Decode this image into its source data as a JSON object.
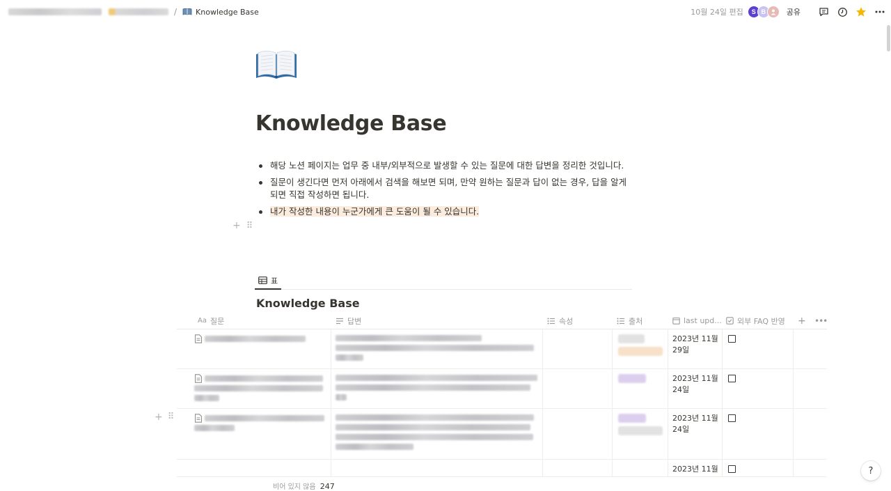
{
  "topbar": {
    "breadcrumb_title": "Knowledge Base",
    "separator": "/",
    "edited": "10월 24일 편집",
    "avatars": [
      "S",
      "B",
      ""
    ],
    "share": "공유"
  },
  "page": {
    "icon": "book-icon",
    "title": "Knowledge Base",
    "bullets": [
      "해당 노션 페이지는 업무 중 내부/외부적으로 발생할 수 있는 질문에 대한 답변을 정리한 것입니다.",
      "질문이 생긴다면 먼저 아래에서 검색을 해보면 되며, 만약 원하는 질문과 답이 없는 경우, 답을 알게 되면 직접 작성하면 됩니다.",
      "내가 작성한 내용이 누군가에게 큰 도움이 될 수 있습니다."
    ]
  },
  "views": {
    "active_tab": "표"
  },
  "database": {
    "title": "Knowledge Base",
    "columns": {
      "question": "질문",
      "question_prefix": "Aa",
      "answer": "답변",
      "property": "속성",
      "source": "출처",
      "last_updated": "last upd...",
      "faq": "외부 FAQ 반영"
    },
    "rows": [
      {
        "date_line1": "2023년 11월",
        "date_line2": "29일",
        "faq_checked": false
      },
      {
        "date_line1": "2023년 11월",
        "date_line2": "24일",
        "faq_checked": false
      },
      {
        "date_line1": "2023년 11월",
        "date_line2": "24일",
        "faq_checked": false
      },
      {
        "date_line1": "2023년 11월",
        "date_line2": "",
        "faq_checked": false
      }
    ],
    "footer_label": "비어 있지 않음",
    "footer_count": "247"
  },
  "colors": {
    "highlight": "#fbecdd",
    "avatar_primary": "#5b3fd1",
    "star": "#f5b700"
  },
  "help": "?"
}
